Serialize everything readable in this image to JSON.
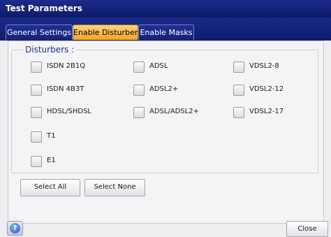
{
  "window": {
    "title": "Test Parameters"
  },
  "tabs": [
    {
      "label": "General Settings",
      "selected": false
    },
    {
      "label": "Enable Disturbers",
      "selected": true
    },
    {
      "label": "Enable Masks",
      "selected": false
    }
  ],
  "disturbers": {
    "title": "Disturbers :",
    "items": [
      {
        "label": "ISDN 2B1Q",
        "checked": false
      },
      {
        "label": "ISDN 4B3T",
        "checked": false
      },
      {
        "label": "HDSL/SHDSL",
        "checked": false
      },
      {
        "label": "T1",
        "checked": false
      },
      {
        "label": "E1",
        "checked": false
      },
      {
        "label": "ADSL",
        "checked": false
      },
      {
        "label": "ADSL2+",
        "checked": false
      },
      {
        "label": "ADSL/ADSL2+",
        "checked": false
      },
      {
        "label": "VDSL2-8",
        "checked": false
      },
      {
        "label": "VDSL2-12",
        "checked": false
      },
      {
        "label": "VDSL2-17",
        "checked": false
      }
    ]
  },
  "buttons": {
    "select_all": "Select All",
    "select_none": "Select None",
    "close": "Close",
    "help_glyph": "?"
  },
  "colors": {
    "titlebar": "#0e1b6a",
    "tab_active": "#f5a623",
    "group_title": "#1d2d8e"
  }
}
